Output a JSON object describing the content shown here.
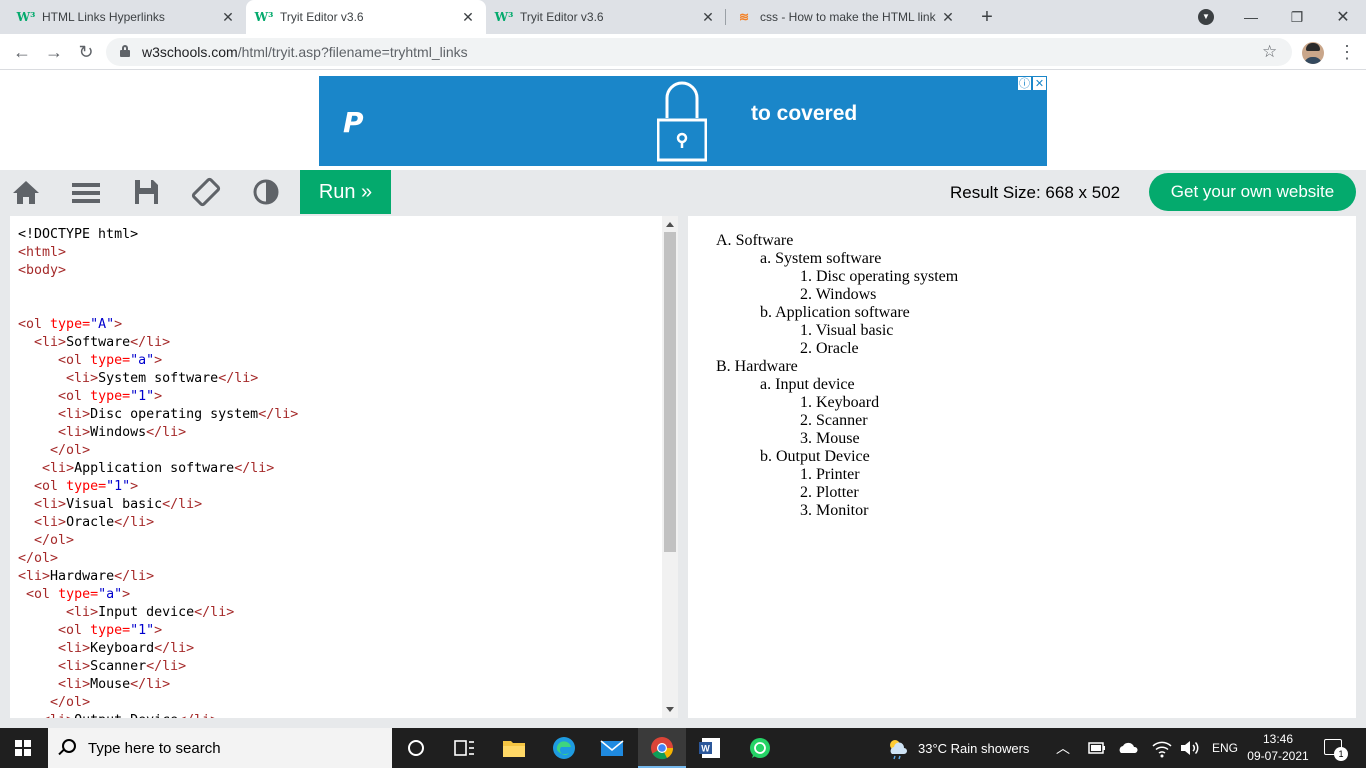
{
  "browser": {
    "tabs": [
      {
        "title": "HTML Links Hyperlinks",
        "favicon": "w3schools-logo",
        "active": false
      },
      {
        "title": "Tryit Editor v3.6",
        "favicon": "w3schools-logo",
        "active": true
      },
      {
        "title": "Tryit Editor v3.6",
        "favicon": "w3schools-logo",
        "active": false
      },
      {
        "title": "css - How to make the HTML link",
        "favicon": "stackoverflow-logo",
        "active": false
      }
    ],
    "url_host": "w3schools.com",
    "url_path": "/html/tryit.asp?filename=tryhtml_links"
  },
  "ad": {
    "text": "to covered",
    "adchoices": [
      "ⓘ",
      "✕"
    ]
  },
  "toolbar": {
    "run_label": "Run »",
    "result_size": "Result Size: 668 x 502",
    "get_website_label": "Get your own website"
  },
  "code_lines": [
    "<!DOCTYPE html>",
    "<html>",
    "<body>",
    "",
    "",
    "<ol type=\"A\">",
    "  <li>Software</li>",
    "     <ol type=\"a\">",
    "      <li>System software</li>",
    "     <ol type=\"1\">",
    "     <li>Disc operating system</li>",
    "     <li>Windows</li>",
    "    </ol>",
    "   <li>Application software</li>",
    "  <ol type=\"1\">",
    "  <li>Visual basic</li>",
    "  <li>Oracle</li>",
    "  </ol>",
    "</ol>",
    "<li>Hardware</li>",
    " <ol type=\"a\">",
    "      <li>Input device</li>",
    "     <ol type=\"1\">",
    "     <li>Keyboard</li>",
    "     <li>Scanner</li>",
    "     <li>Mouse</li>",
    "    </ol>",
    "   <li>Output Device</li>"
  ],
  "result": {
    "lines": [
      {
        "marker": "A.",
        "text": "Software",
        "level": 0
      },
      {
        "marker": "a.",
        "text": "System software",
        "level": 1
      },
      {
        "marker": "1.",
        "text": "Disc operating system",
        "level": 2
      },
      {
        "marker": "2.",
        "text": "Windows",
        "level": 2
      },
      {
        "marker": "b.",
        "text": "Application software",
        "level": 1
      },
      {
        "marker": "1.",
        "text": "Visual basic",
        "level": 2
      },
      {
        "marker": "2.",
        "text": "Oracle",
        "level": 2
      },
      {
        "marker": "B.",
        "text": "Hardware",
        "level": 0
      },
      {
        "marker": "a.",
        "text": "Input device",
        "level": 1
      },
      {
        "marker": "1.",
        "text": "Keyboard",
        "level": 2
      },
      {
        "marker": "2.",
        "text": "Scanner",
        "level": 2
      },
      {
        "marker": "3.",
        "text": "Mouse",
        "level": 2
      },
      {
        "marker": "b.",
        "text": "Output Device",
        "level": 1
      },
      {
        "marker": "1.",
        "text": "Printer",
        "level": 2
      },
      {
        "marker": "2.",
        "text": "Plotter",
        "level": 2
      },
      {
        "marker": "3.",
        "text": "Monitor",
        "level": 2
      }
    ]
  },
  "taskbar": {
    "search_placeholder": "Type here to search",
    "weather": "33°C  Rain showers",
    "language": "ENG",
    "time": "13:46",
    "date": "09-07-2021",
    "notification_count": "1"
  },
  "colors": {
    "w3_green": "#04aa6d",
    "ad_blue": "#1a86c9",
    "code_tag": "#a52a2a",
    "code_attr": "#ff0000",
    "code_value": "#0000cd"
  }
}
